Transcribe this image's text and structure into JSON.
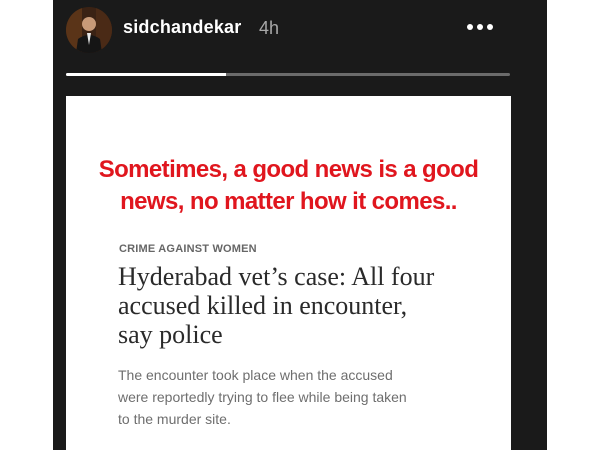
{
  "story_header": {
    "username": "sidchandekar",
    "time_ago": "4h",
    "progress_fraction": 0.36
  },
  "post": {
    "headline_lines": [
      "Sometimes, a good news is a good",
      "news, no matter how it comes.."
    ],
    "article": {
      "category": "CRIME AGAINST WOMEN",
      "title_lines": [
        "Hyderabad vet’s case: All four",
        "accused killed in encounter,",
        "say police"
      ],
      "summary_lines": [
        "The encounter took place when the accused",
        "were reportedly trying to flee while being taken",
        "to the murder site."
      ]
    }
  },
  "icons": {
    "menu": "more-horizontal-icon",
    "close": "close-icon"
  },
  "colors": {
    "story_background": "#1a1a1a",
    "headline_red": "#e0161e",
    "progress_track": "#6b6b6b",
    "progress_fill": "#ffffff"
  }
}
